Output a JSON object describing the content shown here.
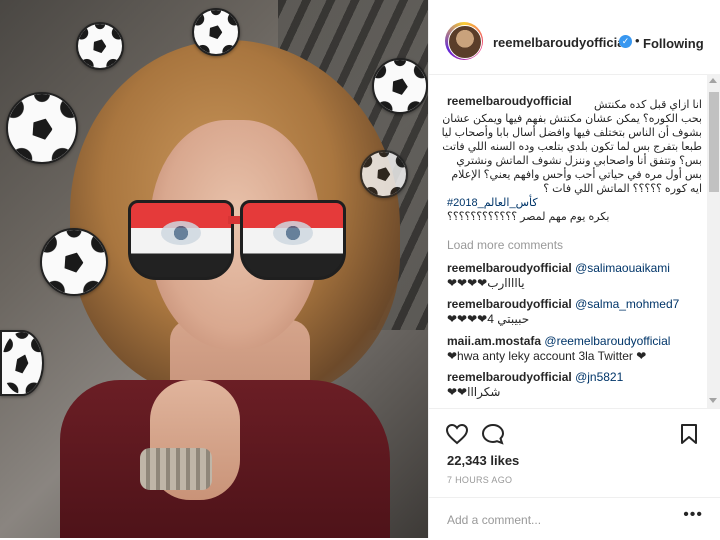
{
  "header": {
    "username": "reemelbaroudyofficial",
    "verified_icon": "verified-badge-icon",
    "dot": "•",
    "follow_status": "Following"
  },
  "caption": {
    "username": "reemelbaroudyofficial",
    "lines": [
      "انا ازاي قبل كده مكنتش",
      "بحب الكوره؟ يمكن عشان مكنتش بفهم فيها ويمكن عشان",
      "بشوف أن الناس بتختلف فيها وافضل أسال بابا وأصحاب ليا",
      "طبعا بتفرج بس لما تكون بلدي بتلعب وده السنه اللي فاتت",
      "بس؟ وتتفق أنا واصحابي وننزل نشوف الماتش ونشتري",
      "بس أول مره في حياتي أحب وأحس وافهم يعني؟ الإعلام",
      "ايه كوره ؟؟؟؟؟ الماتش اللي فات ؟",
      "#كأس_العالم_2018",
      "بكره يوم مهم لمصر ؟؟؟؟؟؟؟؟؟؟؟؟"
    ]
  },
  "load_more": "Load more comments",
  "comments": [
    {
      "user": "reemelbaroudyofficial",
      "mention": "@salimaouaikami",
      "text": "❤❤❤❤يااااارب"
    },
    {
      "user": "reemelbaroudyofficial",
      "mention": "@salma_mohmed7",
      "text": "❤❤❤❤حبيبتي 4"
    },
    {
      "user": "maii.am.mostafa",
      "mention": "@reemelbaroudyofficial",
      "text": "❤hwa anty leky account 3la Twitter ❤"
    },
    {
      "user": "reemelbaroudyofficial",
      "mention": "@jn5821",
      "text": "❤❤شكرااا"
    }
  ],
  "actions": {
    "like_icon": "heart-icon",
    "comment_icon": "comment-icon",
    "save_icon": "bookmark-icon"
  },
  "likes": "22,343 likes",
  "timestamp": "7 HOURS AGO",
  "add_comment_placeholder": "Add a comment...",
  "more_options": "•••"
}
